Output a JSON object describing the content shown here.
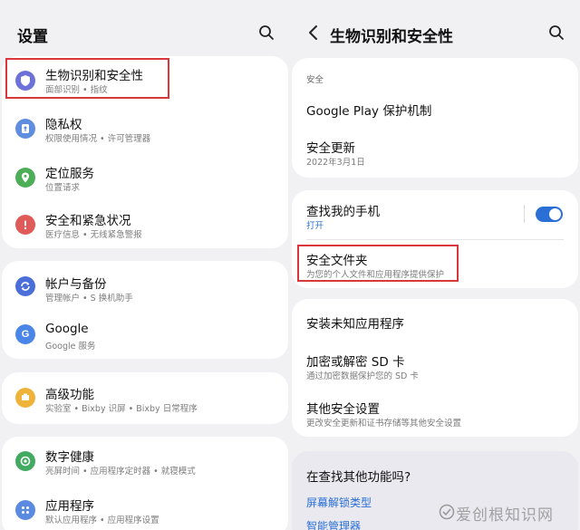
{
  "left": {
    "title": "设置",
    "groups": [
      {
        "items": [
          {
            "title": "生物识别和安全性",
            "subtitle": "面部识别 • 指纹",
            "icon": "shield-icon",
            "color": "#6c72d9"
          },
          {
            "title": "隐私权",
            "subtitle": "权限使用情况 • 许可管理器",
            "icon": "privacy-icon",
            "color": "#5f8de0"
          },
          {
            "title": "定位服务",
            "subtitle": "位置请求",
            "icon": "location-icon",
            "color": "#4cae57"
          },
          {
            "title": "安全和紧急状况",
            "subtitle": "医疗信息 • 无线紧急警报",
            "icon": "emergency-icon",
            "color": "#e05a5a"
          }
        ]
      },
      {
        "items": [
          {
            "title": "帐户与备份",
            "subtitle": "管理帐户 • S 换机助手",
            "icon": "sync-icon",
            "color": "#4a6fd8"
          },
          {
            "title": "Google",
            "subtitle": "Google 服务",
            "icon": "google-icon",
            "color": "#4a86e8"
          }
        ]
      },
      {
        "items": [
          {
            "title": "高级功能",
            "subtitle": "实验室 • Bixby 识屏 • Bixby 日常程序",
            "icon": "advanced-features-icon",
            "color": "#f0b33a"
          }
        ]
      },
      {
        "items": [
          {
            "title": "数字健康",
            "subtitle": "亮屏时间 • 应用程序定时器 • 就寝模式",
            "icon": "digital-wellbeing-icon",
            "color": "#43ab61"
          },
          {
            "title": "应用程序",
            "subtitle": "默认应用程序 • 应用程序设置",
            "icon": "apps-icon",
            "color": "#5b8be0"
          }
        ]
      }
    ]
  },
  "right": {
    "title": "生物识别和安全性",
    "section_label": "安全",
    "group1": [
      {
        "title": "Google Play 保护机制",
        "subtitle": ""
      },
      {
        "title": "安全更新",
        "subtitle": "2022年3月1日"
      }
    ],
    "group2": [
      {
        "title": "查找我的手机",
        "subtitle": "打开",
        "toggle": true
      },
      {
        "title": "安全文件夹",
        "subtitle": "为您的个人文件和应用程序提供保护"
      }
    ],
    "group3": [
      {
        "title": "安装未知应用程序",
        "subtitle": ""
      },
      {
        "title": "加密或解密 SD 卡",
        "subtitle": "通过加密数据保护您的 SD 卡"
      },
      {
        "title": "其他安全设置",
        "subtitle": "更改安全更新和证书存储等其他安全设置"
      }
    ],
    "looking": {
      "prompt": "在查找其他功能吗?",
      "links": [
        "屏幕解锁类型",
        "智能管理器"
      ]
    }
  },
  "watermark": "爱创根知识网",
  "colors": {
    "accent": "#2a6fd6",
    "highlight": "#d9373b"
  }
}
